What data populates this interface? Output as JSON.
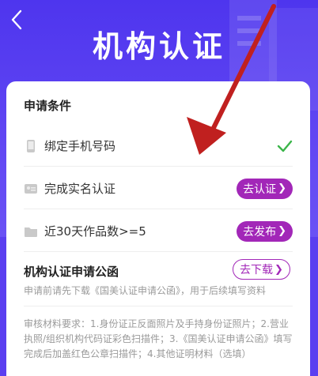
{
  "header": {
    "title": "机构认证"
  },
  "conditions": {
    "section_title": "申请条件",
    "items": [
      {
        "icon": "phone-icon",
        "label": "绑定手机号码",
        "status": "done"
      },
      {
        "icon": "id-card-icon",
        "label": "完成实名认证",
        "action": "去认证"
      },
      {
        "icon": "folder-icon",
        "label": "近30天作品数>=5",
        "action": "去发布"
      }
    ]
  },
  "letter": {
    "title": "机构认证申请公函",
    "action": "去下载",
    "hint": "申请前请先下载《国美认证申请公函》，用于后续填写资料"
  },
  "materials": {
    "text": "审核材料要求：1.身份证正反面照片及手持身份证照片；2.营业执照/组织机构代码证彩色扫描件；3.《国美认证申请公函》填写完成后加盖红色公章扫描件；4.其他证明材料（选填）"
  },
  "colors": {
    "hero": "#5b3ff0",
    "accent": "#a227b8",
    "check": "#3bb54a",
    "annotation_arrow": "#c0201f"
  }
}
